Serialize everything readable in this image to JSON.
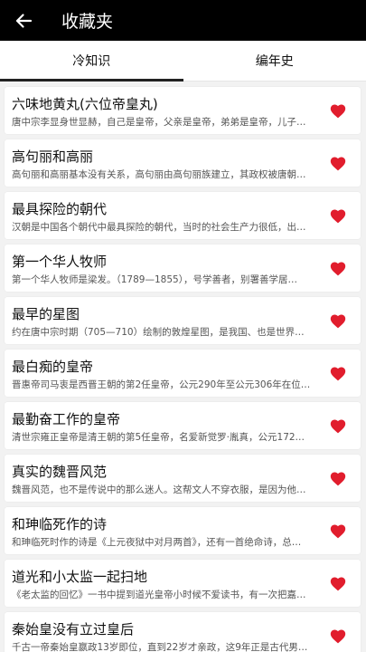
{
  "header": {
    "title": "收藏夹",
    "back_icon": "arrow-left-icon"
  },
  "tabs": [
    {
      "label": "冷知识",
      "active": true
    },
    {
      "label": "编年史",
      "active": false
    }
  ],
  "colors": {
    "heart": "#e11d2d",
    "app_bar": "#000000"
  },
  "items": [
    {
      "title": "六味地黄丸(六位帝皇丸)",
      "desc": "唐中宗李显身世显赫，自己是皇帝，父亲是皇帝，弟弟是皇帝，儿子…"
    },
    {
      "title": "高句丽和高丽",
      "desc": "高句丽和高丽基本没有关系，高句丽由高句丽族建立，其政权被唐朝…"
    },
    {
      "title": "最具探险的朝代",
      "desc": "汉朝是中国各个朝代中最具探险的朝代，当时的社会生产力很低，出…"
    },
    {
      "title": "第一个华人牧师",
      "desc": "第一个华人牧师是梁发。（1789—1855），号学善者，别署善学居…"
    },
    {
      "title": "最早的星图",
      "desc": "约在唐中宗时期（705—710）绘制的敦煌星图，是我国、也是世界…"
    },
    {
      "title": "最白痴的皇帝",
      "desc": "晋惠帝司马衷是西晋王朝的第2任皇帝，公元290年至公元306年在位…"
    },
    {
      "title": "最勤奋工作的皇帝",
      "desc": "清世宗雍正皇帝是清王朝的第5任皇帝，名爱新觉罗·胤真，公元172…"
    },
    {
      "title": "真实的魏晋风范",
      "desc": "魏晋风范，也不是传说中的那么迷人。这帮文人不穿衣服，是因为他…"
    },
    {
      "title": "和珅临死作的诗",
      "desc": "和珅临死时作的诗是《上元夜狱中对月两首》，还有一首绝命诗，总…"
    },
    {
      "title": "道光和小太监一起扫地",
      "desc": "《老太监的回忆》一书中提到道光皇帝小时候不爱读书，有一次把嘉…"
    },
    {
      "title": "秦始皇没有立过皇后",
      "desc": "千古一帝秦始皇嬴政13岁即位，直到22岁才亲政，这9年正是古代男…"
    }
  ]
}
